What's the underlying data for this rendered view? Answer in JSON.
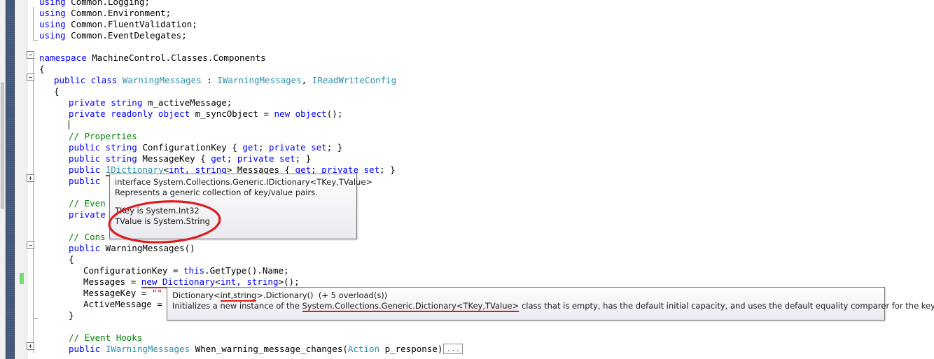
{
  "app": {
    "kind": "visual-studio-code-editor",
    "language": "csharp"
  },
  "colors": {
    "keyword": "#0000FF",
    "type": "#2B91AF",
    "comment": "#008000",
    "string": "#A31515",
    "error_underline": "#E01B1B",
    "change_bar": "#6FDF6F",
    "marker_band": "#3D5378",
    "gutter": "#F0F0F0",
    "annotation": "#E01B1B"
  },
  "editor": {
    "lines": [
      {
        "indent": 0,
        "partial_top": true,
        "tokens": [
          {
            "t": "using",
            "c": "kw"
          },
          {
            "t": " Common.Logging;",
            "c": "pl"
          }
        ]
      },
      {
        "indent": 0,
        "tokens": [
          {
            "t": "using",
            "c": "kw"
          },
          {
            "t": " Common.Environment;",
            "c": "pl"
          }
        ]
      },
      {
        "indent": 0,
        "tokens": [
          {
            "t": "using",
            "c": "kw"
          },
          {
            "t": " Common.FluentValidation;",
            "c": "pl"
          }
        ]
      },
      {
        "indent": 0,
        "tokens": [
          {
            "t": "using",
            "c": "kw"
          },
          {
            "t": " Common.EventDelegates;",
            "c": "pl"
          }
        ]
      },
      {
        "indent": 0,
        "tokens": []
      },
      {
        "indent": 0,
        "tokens": [
          {
            "t": "namespace",
            "c": "kw"
          },
          {
            "t": " MachineControl.Classes.Components",
            "c": "pl"
          }
        ]
      },
      {
        "indent": 0,
        "tokens": [
          {
            "t": "{",
            "c": "pl"
          }
        ]
      },
      {
        "indent": 1,
        "tokens": [
          {
            "t": "public class",
            "c": "kw"
          },
          {
            "t": " ",
            "c": "pl"
          },
          {
            "t": "WarningMessages",
            "c": "typ"
          },
          {
            "t": " : ",
            "c": "pl"
          },
          {
            "t": "IWarningMessages",
            "c": "typ"
          },
          {
            "t": ", ",
            "c": "pl"
          },
          {
            "t": "IReadWriteConfig",
            "c": "typ"
          }
        ]
      },
      {
        "indent": 1,
        "tokens": [
          {
            "t": "{",
            "c": "pl"
          }
        ]
      },
      {
        "indent": 2,
        "tokens": [
          {
            "t": "private string",
            "c": "kw"
          },
          {
            "t": " m_activeMessage;",
            "c": "pl"
          }
        ]
      },
      {
        "indent": 2,
        "tokens": [
          {
            "t": "private readonly object",
            "c": "kw"
          },
          {
            "t": " m_syncObject = ",
            "c": "pl"
          },
          {
            "t": "new object",
            "c": "kw"
          },
          {
            "t": "();",
            "c": "pl"
          }
        ]
      },
      {
        "indent": 2,
        "caret": true,
        "tokens": []
      },
      {
        "indent": 2,
        "tokens": [
          {
            "t": "// Properties",
            "c": "cm"
          }
        ]
      },
      {
        "indent": 2,
        "tokens": [
          {
            "t": "public string",
            "c": "kw"
          },
          {
            "t": " ConfigurationKey { ",
            "c": "pl"
          },
          {
            "t": "get",
            "c": "kw"
          },
          {
            "t": "; ",
            "c": "pl"
          },
          {
            "t": "private set",
            "c": "kw"
          },
          {
            "t": "; }",
            "c": "pl"
          }
        ]
      },
      {
        "indent": 2,
        "tokens": [
          {
            "t": "public string",
            "c": "kw"
          },
          {
            "t": " MessageKey { ",
            "c": "pl"
          },
          {
            "t": "get",
            "c": "kw"
          },
          {
            "t": "; ",
            "c": "pl"
          },
          {
            "t": "private set",
            "c": "kw"
          },
          {
            "t": "; }",
            "c": "pl"
          }
        ]
      },
      {
        "indent": 2,
        "tokens": [
          {
            "t": "public",
            "c": "kw"
          },
          {
            "t": " ",
            "c": "pl"
          },
          {
            "t": "IDictionary",
            "c": "typ",
            "squiggle": true
          },
          {
            "t": "<",
            "c": "pl",
            "squiggle": true
          },
          {
            "t": "int, string",
            "c": "kw",
            "squiggle": true
          },
          {
            "t": ">",
            "c": "pl",
            "squiggle": true
          },
          {
            "t": " Messages { ",
            "c": "pl"
          },
          {
            "t": "get",
            "c": "kw"
          },
          {
            "t": "; ",
            "c": "pl"
          },
          {
            "t": "private set",
            "c": "kw"
          },
          {
            "t": "; }",
            "c": "pl"
          }
        ]
      },
      {
        "indent": 2,
        "tokens": [
          {
            "t": "public",
            "c": "kw"
          }
        ]
      },
      {
        "indent": 2,
        "tokens": []
      },
      {
        "indent": 2,
        "tokens": [
          {
            "t": "// Even",
            "c": "cm"
          }
        ]
      },
      {
        "indent": 2,
        "tokens": [
          {
            "t": "private",
            "c": "kw"
          }
        ]
      },
      {
        "indent": 2,
        "tokens": []
      },
      {
        "indent": 2,
        "tokens": [
          {
            "t": "// Cons",
            "c": "cm"
          }
        ]
      },
      {
        "indent": 2,
        "tokens": [
          {
            "t": "public",
            "c": "kw"
          },
          {
            "t": " WarningMessages()",
            "c": "pl"
          }
        ]
      },
      {
        "indent": 2,
        "tokens": [
          {
            "t": "{",
            "c": "pl"
          }
        ]
      },
      {
        "indent": 3,
        "tokens": [
          {
            "t": "ConfigurationKey = ",
            "c": "pl"
          },
          {
            "t": "this",
            "c": "kw"
          },
          {
            "t": ".GetType().Name;",
            "c": "pl"
          }
        ]
      },
      {
        "indent": 3,
        "changed": true,
        "tokens": [
          {
            "t": "Messages = ",
            "c": "pl"
          },
          {
            "t": "new Dictionary",
            "c": "kw",
            "squiggle": true
          },
          {
            "t": "<",
            "c": "pl",
            "squiggle": true
          },
          {
            "t": "int, string",
            "c": "kw",
            "squiggle": true
          },
          {
            "t": ">",
            "c": "pl",
            "squiggle": true
          },
          {
            "t": "();",
            "c": "pl"
          }
        ]
      },
      {
        "indent": 3,
        "tokens": [
          {
            "t": "MessageKey = ",
            "c": "pl"
          },
          {
            "t": "\"\"",
            "c": "str"
          }
        ]
      },
      {
        "indent": 3,
        "tokens": [
          {
            "t": "ActiveMessage =",
            "c": "pl"
          }
        ]
      },
      {
        "indent": 2,
        "tokens": [
          {
            "t": "}",
            "c": "pl"
          }
        ]
      },
      {
        "indent": 2,
        "tokens": []
      },
      {
        "indent": 2,
        "tokens": [
          {
            "t": "// Event Hooks",
            "c": "cm"
          }
        ]
      },
      {
        "indent": 2,
        "collapsed_suffix": "...",
        "tokens": [
          {
            "t": "public",
            "c": "kw"
          },
          {
            "t": " ",
            "c": "pl"
          },
          {
            "t": "IWarningMessages",
            "c": "typ"
          },
          {
            "t": " When_warning_message_changes(",
            "c": "pl"
          },
          {
            "t": "Action",
            "c": "typ"
          },
          {
            "t": " p_response)",
            "c": "pl"
          }
        ]
      }
    ]
  },
  "tooltip_idictionary": {
    "name": "intellisense-quickinfo-idictionary",
    "line1": "interface System.Collections.Generic.IDictionary<TKey,TValue>",
    "line2": "Represents a generic collection of key/value pairs.",
    "line3": "TKey is System.Int32",
    "line4": "TValue is System.String"
  },
  "tooltip_dictionary_ctor": {
    "name": "intellisense-signature-help-dictionary",
    "signature_prefix": "Dictionary<",
    "signature_generic": "int,string",
    "signature_suffix": ">.Dictionary()",
    "overloads": "(+ 5 overload(s))",
    "summary_prefix": "Initializes a new instance of the ",
    "summary_type": "System.Collections.Generic.Dictionary<TKey,TValue>",
    "summary_suffix": " class that is empty, has the default initial capacity, and uses the default equality comparer for the key type."
  },
  "annotations": {
    "ellipse_label": "red-hand-drawn-ellipse-highlighting-generic-type-arguments"
  }
}
